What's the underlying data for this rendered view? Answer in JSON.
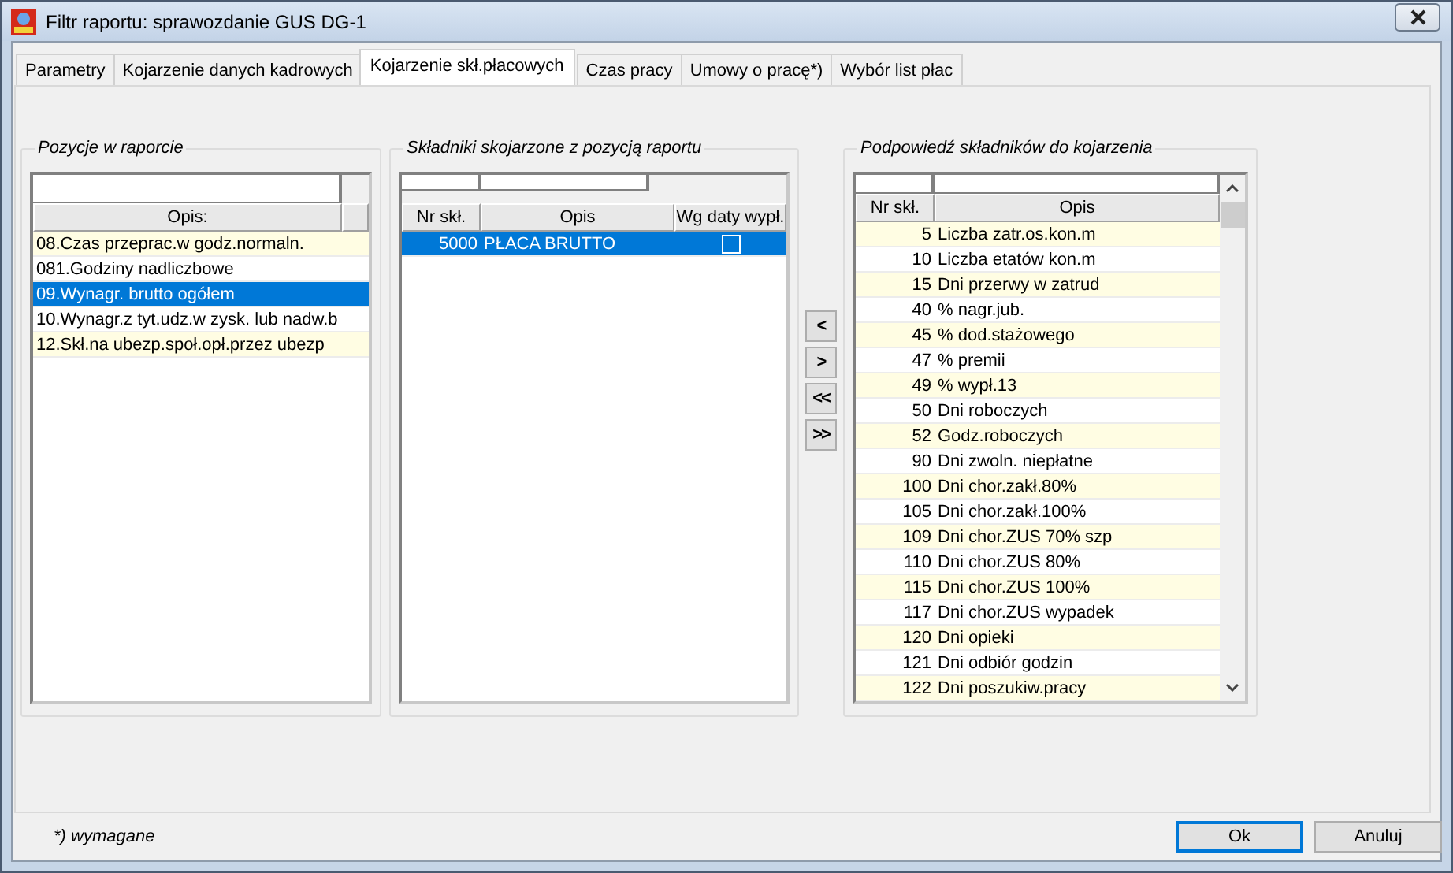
{
  "window": {
    "title": "Filtr raportu: sprawozdanie GUS DG-1"
  },
  "tabs": [
    {
      "label": "Parametry",
      "selected": false
    },
    {
      "label": "Kojarzenie danych kadrowych",
      "selected": false
    },
    {
      "label": "Kojarzenie skł.płacowych",
      "selected": true
    },
    {
      "label": "Czas pracy",
      "selected": false
    },
    {
      "label": "Umowy o pracę*)",
      "selected": false
    },
    {
      "label": "Wybór list płac",
      "selected": false
    }
  ],
  "positions": {
    "title": "Pozycje w raporcie",
    "columns": [
      "Opis:"
    ],
    "rows": [
      {
        "opis": "08.Czas przeprac.w godz.normaln.",
        "selected": false
      },
      {
        "opis": "081.Godziny nadliczbowe",
        "selected": false
      },
      {
        "opis": "09.Wynagr. brutto ogółem",
        "selected": true
      },
      {
        "opis": "10.Wynagr.z tyt.udz.w zysk. lub nadw.b",
        "selected": false
      },
      {
        "opis": "12.Skł.na ubezp.społ.opł.przez ubezp",
        "selected": false
      }
    ]
  },
  "linked": {
    "title": "Składniki skojarzone z pozycją raportu",
    "columns": [
      "Nr skł.",
      "Opis",
      "Wg daty wypł."
    ],
    "rows": [
      {
        "nr": "5000",
        "opis": "PŁACA BRUTTO",
        "wg_daty": false,
        "selected": true
      }
    ]
  },
  "move_buttons": [
    "<",
    ">",
    "<<",
    ">>"
  ],
  "suggestions": {
    "title": "Podpowiedź składników do kojarzenia",
    "columns": [
      "Nr skł.",
      "Opis"
    ],
    "rows": [
      {
        "nr": "5",
        "opis": "Liczba zatr.os.kon.m",
        "selected": false
      },
      {
        "nr": "10",
        "opis": "Liczba etatów kon.m",
        "selected": false
      },
      {
        "nr": "15",
        "opis": "Dni przerwy w zatrud",
        "selected": false
      },
      {
        "nr": "40",
        "opis": "% nagr.jub.",
        "selected": false
      },
      {
        "nr": "45",
        "opis": "% dod.stażowego",
        "selected": false
      },
      {
        "nr": "47",
        "opis": "% premii",
        "selected": false
      },
      {
        "nr": "49",
        "opis": "% wypł.13",
        "selected": false
      },
      {
        "nr": "50",
        "opis": "Dni roboczych",
        "selected": false
      },
      {
        "nr": "52",
        "opis": "Godz.roboczych",
        "selected": false
      },
      {
        "nr": "90",
        "opis": "Dni zwoln. niepłatne",
        "selected": false
      },
      {
        "nr": "100",
        "opis": "Dni chor.zakł.80%",
        "selected": false
      },
      {
        "nr": "105",
        "opis": "Dni chor.zakł.100%",
        "selected": false
      },
      {
        "nr": "109",
        "opis": "Dni chor.ZUS 70% szp",
        "selected": false
      },
      {
        "nr": "110",
        "opis": "Dni chor.ZUS 80%",
        "selected": false
      },
      {
        "nr": "115",
        "opis": "Dni chor.ZUS 100%",
        "selected": false
      },
      {
        "nr": "117",
        "opis": "Dni chor.ZUS wypadek",
        "selected": false
      },
      {
        "nr": "120",
        "opis": "Dni opieki",
        "selected": false
      },
      {
        "nr": "121",
        "opis": "Dni odbiór godzin",
        "selected": false
      },
      {
        "nr": "122",
        "opis": "Dni poszukiw.pracy",
        "selected": false
      }
    ]
  },
  "footnote": "*) wymagane",
  "buttons": [
    {
      "label": "Ok",
      "default": true
    },
    {
      "label": "Anuluj",
      "default": false
    }
  ]
}
